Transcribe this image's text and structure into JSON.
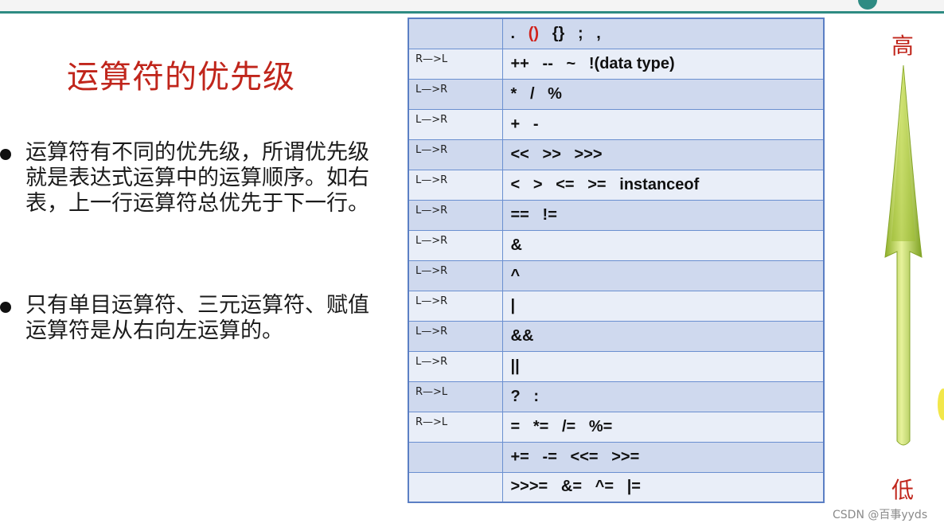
{
  "heading": "运算符的优先级",
  "bullets": [
    "运算符有不同的优先级，所谓优先级就是表达式运算中的运算顺序。如右表，上一行运算符总优先于下一行。",
    "只有单目运算符、三元运算符、赋值运算符是从右向左运算的。"
  ],
  "table": {
    "rows": [
      {
        "dir": "",
        "ops_pre": ".   ",
        "ops_hl": "()",
        "ops_post": "   {}   ;   ,"
      },
      {
        "dir": "R—>L",
        "ops": "++   --   ~   !(data type)"
      },
      {
        "dir": "L—>R",
        "ops": "*   /   %"
      },
      {
        "dir": "L—>R",
        "ops": "+   -"
      },
      {
        "dir": "L—>R",
        "ops": "<<   >>   >>>"
      },
      {
        "dir": "L—>R",
        "ops": "<   >   <=   >=   instanceof"
      },
      {
        "dir": "L—>R",
        "ops": "==   !="
      },
      {
        "dir": "L—>R",
        "ops": "&"
      },
      {
        "dir": "L—>R",
        "ops": "^"
      },
      {
        "dir": "L—>R",
        "ops": "|"
      },
      {
        "dir": "L—>R",
        "ops": "&&"
      },
      {
        "dir": "L—>R",
        "ops": "||"
      },
      {
        "dir": "R—>L",
        "ops": "?   :"
      },
      {
        "dir": "R—>L",
        "ops": "=   *=   /=   %="
      },
      {
        "dir": "",
        "ops": "+=   -=   <<=   >>="
      },
      {
        "dir": "",
        "ops": ">>>=   &=   ^=   |="
      }
    ]
  },
  "arrow": {
    "high_label": "高",
    "low_label": "低",
    "icon": "up-arrow-icon",
    "color": "#a8c83a"
  },
  "watermark": "CSDN @百事yyds",
  "colors": {
    "heading": "#c0251b",
    "row_dark": "#cfd9ee",
    "row_light": "#e9eef8",
    "border": "#6a8fd0"
  }
}
